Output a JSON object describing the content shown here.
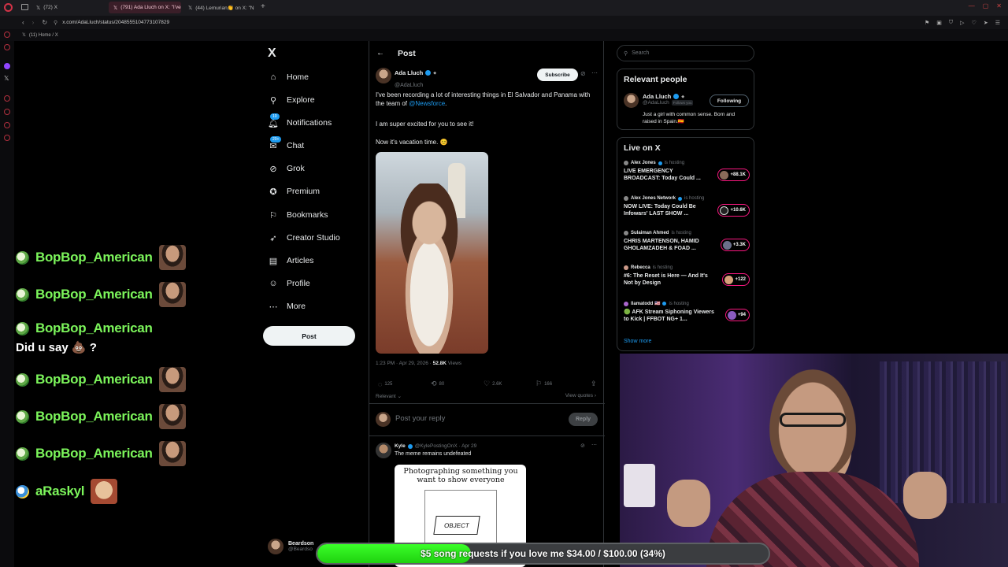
{
  "browser": {
    "tabs": [
      {
        "label": "(72) X"
      },
      {
        "label": "(791) Ada Lluch on X: \"I've"
      },
      {
        "label": "(44) Lemurian👏 on X: \"N"
      }
    ],
    "url": "x.com/AdaLluch/status/2048555104773107829",
    "bookmark": "(11) Home / X"
  },
  "chat": {
    "lines": [
      {
        "name": "BopBop_American"
      },
      {
        "name": "BopBop_American"
      },
      {
        "name": "BopBop_American"
      },
      {
        "name": "BopBop_American"
      },
      {
        "name": "BopBop_American"
      },
      {
        "name": "BopBop_American"
      },
      {
        "name": "aRaskyl"
      }
    ],
    "message": "Did u say 💩 ?"
  },
  "nav": {
    "logo": "X",
    "items": [
      {
        "label": "Home",
        "icon": "home-icon"
      },
      {
        "label": "Explore",
        "icon": "search-icon"
      },
      {
        "label": "Notifications",
        "icon": "bell-icon",
        "badge": "10"
      },
      {
        "label": "Chat",
        "icon": "chat-icon",
        "badge": "20+"
      },
      {
        "label": "Grok",
        "icon": "grok-icon"
      },
      {
        "label": "Premium",
        "icon": "premium-icon"
      },
      {
        "label": "Bookmarks",
        "icon": "bookmark-icon"
      },
      {
        "label": "Creator Studio",
        "icon": "rocket-icon"
      },
      {
        "label": "Articles",
        "icon": "articles-icon"
      },
      {
        "label": "Profile",
        "icon": "profile-icon"
      },
      {
        "label": "More",
        "icon": "more-icon"
      }
    ],
    "post_button": "Post",
    "account_name": "Beardson",
    "account_handle": "@Beardso"
  },
  "post": {
    "header": "Post",
    "author_name": "Ada Lluch",
    "author_handle": "@AdaLluch",
    "subscribe": "Subscribe",
    "text_1": "I've been recording a lot of interesting things in El Salvador and Panama with the team of ",
    "text_1_link": "@Newsforce",
    "text_1_end": ".",
    "text_2": "I am super excited for you to see it!",
    "text_3": "Now it's vacation time. 😊",
    "time": "1:23 PM · Apr 29, 2026 · ",
    "views_count": "52.8K",
    "views_label": " Views",
    "replies": "125",
    "reposts": "80",
    "likes": "2.6K",
    "bookmarks": "166",
    "sort": "Relevant",
    "view_quotes": "View quotes",
    "reply_placeholder": "Post your reply",
    "reply_button": "Reply"
  },
  "reply": {
    "name": "Kyle",
    "handle": "@KylePostingOnX · Apr 29",
    "text": "The meme remains undefeated",
    "meme_caption": "Photographing something you want to show everyone",
    "meme_object": "OBJECT"
  },
  "sidebar": {
    "search_placeholder": "Search",
    "relevant_title": "Relevant people",
    "person_name": "Ada Lluch",
    "person_handle": "@AdaLluch",
    "person_follows": "Follows you",
    "following_button": "Following",
    "person_bio": "Just a girl with common sense. Born and raised in Spain.🇪🇸",
    "live_title": "Live on X",
    "hosting_label": "is hosting",
    "live": [
      {
        "host": "Alex Jones",
        "title": "LIVE EMERGENCY BROADCAST: Today Could ...",
        "count": "+88.1K"
      },
      {
        "host": "Alex Jones Network",
        "title": "NOW LIVE: Today Could Be Infowars' LAST SHOW ...",
        "count": "+10.6K"
      },
      {
        "host": "Sulaiman Ahmed",
        "title": "CHRIS MARTENSON, HAMID GHOLAMZADEH & FOAD ...",
        "count": "+3.3K"
      },
      {
        "host": "Rebecca",
        "title": "#6: The Reset is Here — And It's Not by Design",
        "count": "+122"
      },
      {
        "host": "llamatodd 🇺🇸",
        "title": "🟢 AFK Stream Siphoning Viewers to Kick | FFBOT NG+ 1...",
        "count": "+94"
      }
    ],
    "show_more": "Show more"
  },
  "donation": {
    "text": "$5 song requests if you love me $34.00 / $100.00 (34%)",
    "progress": 0.34
  },
  "colors": {
    "accent": "#1d9bf0",
    "chat_name": "#7cf55b",
    "live_ring": "#f91880",
    "donation_fill": "#2be81a"
  }
}
